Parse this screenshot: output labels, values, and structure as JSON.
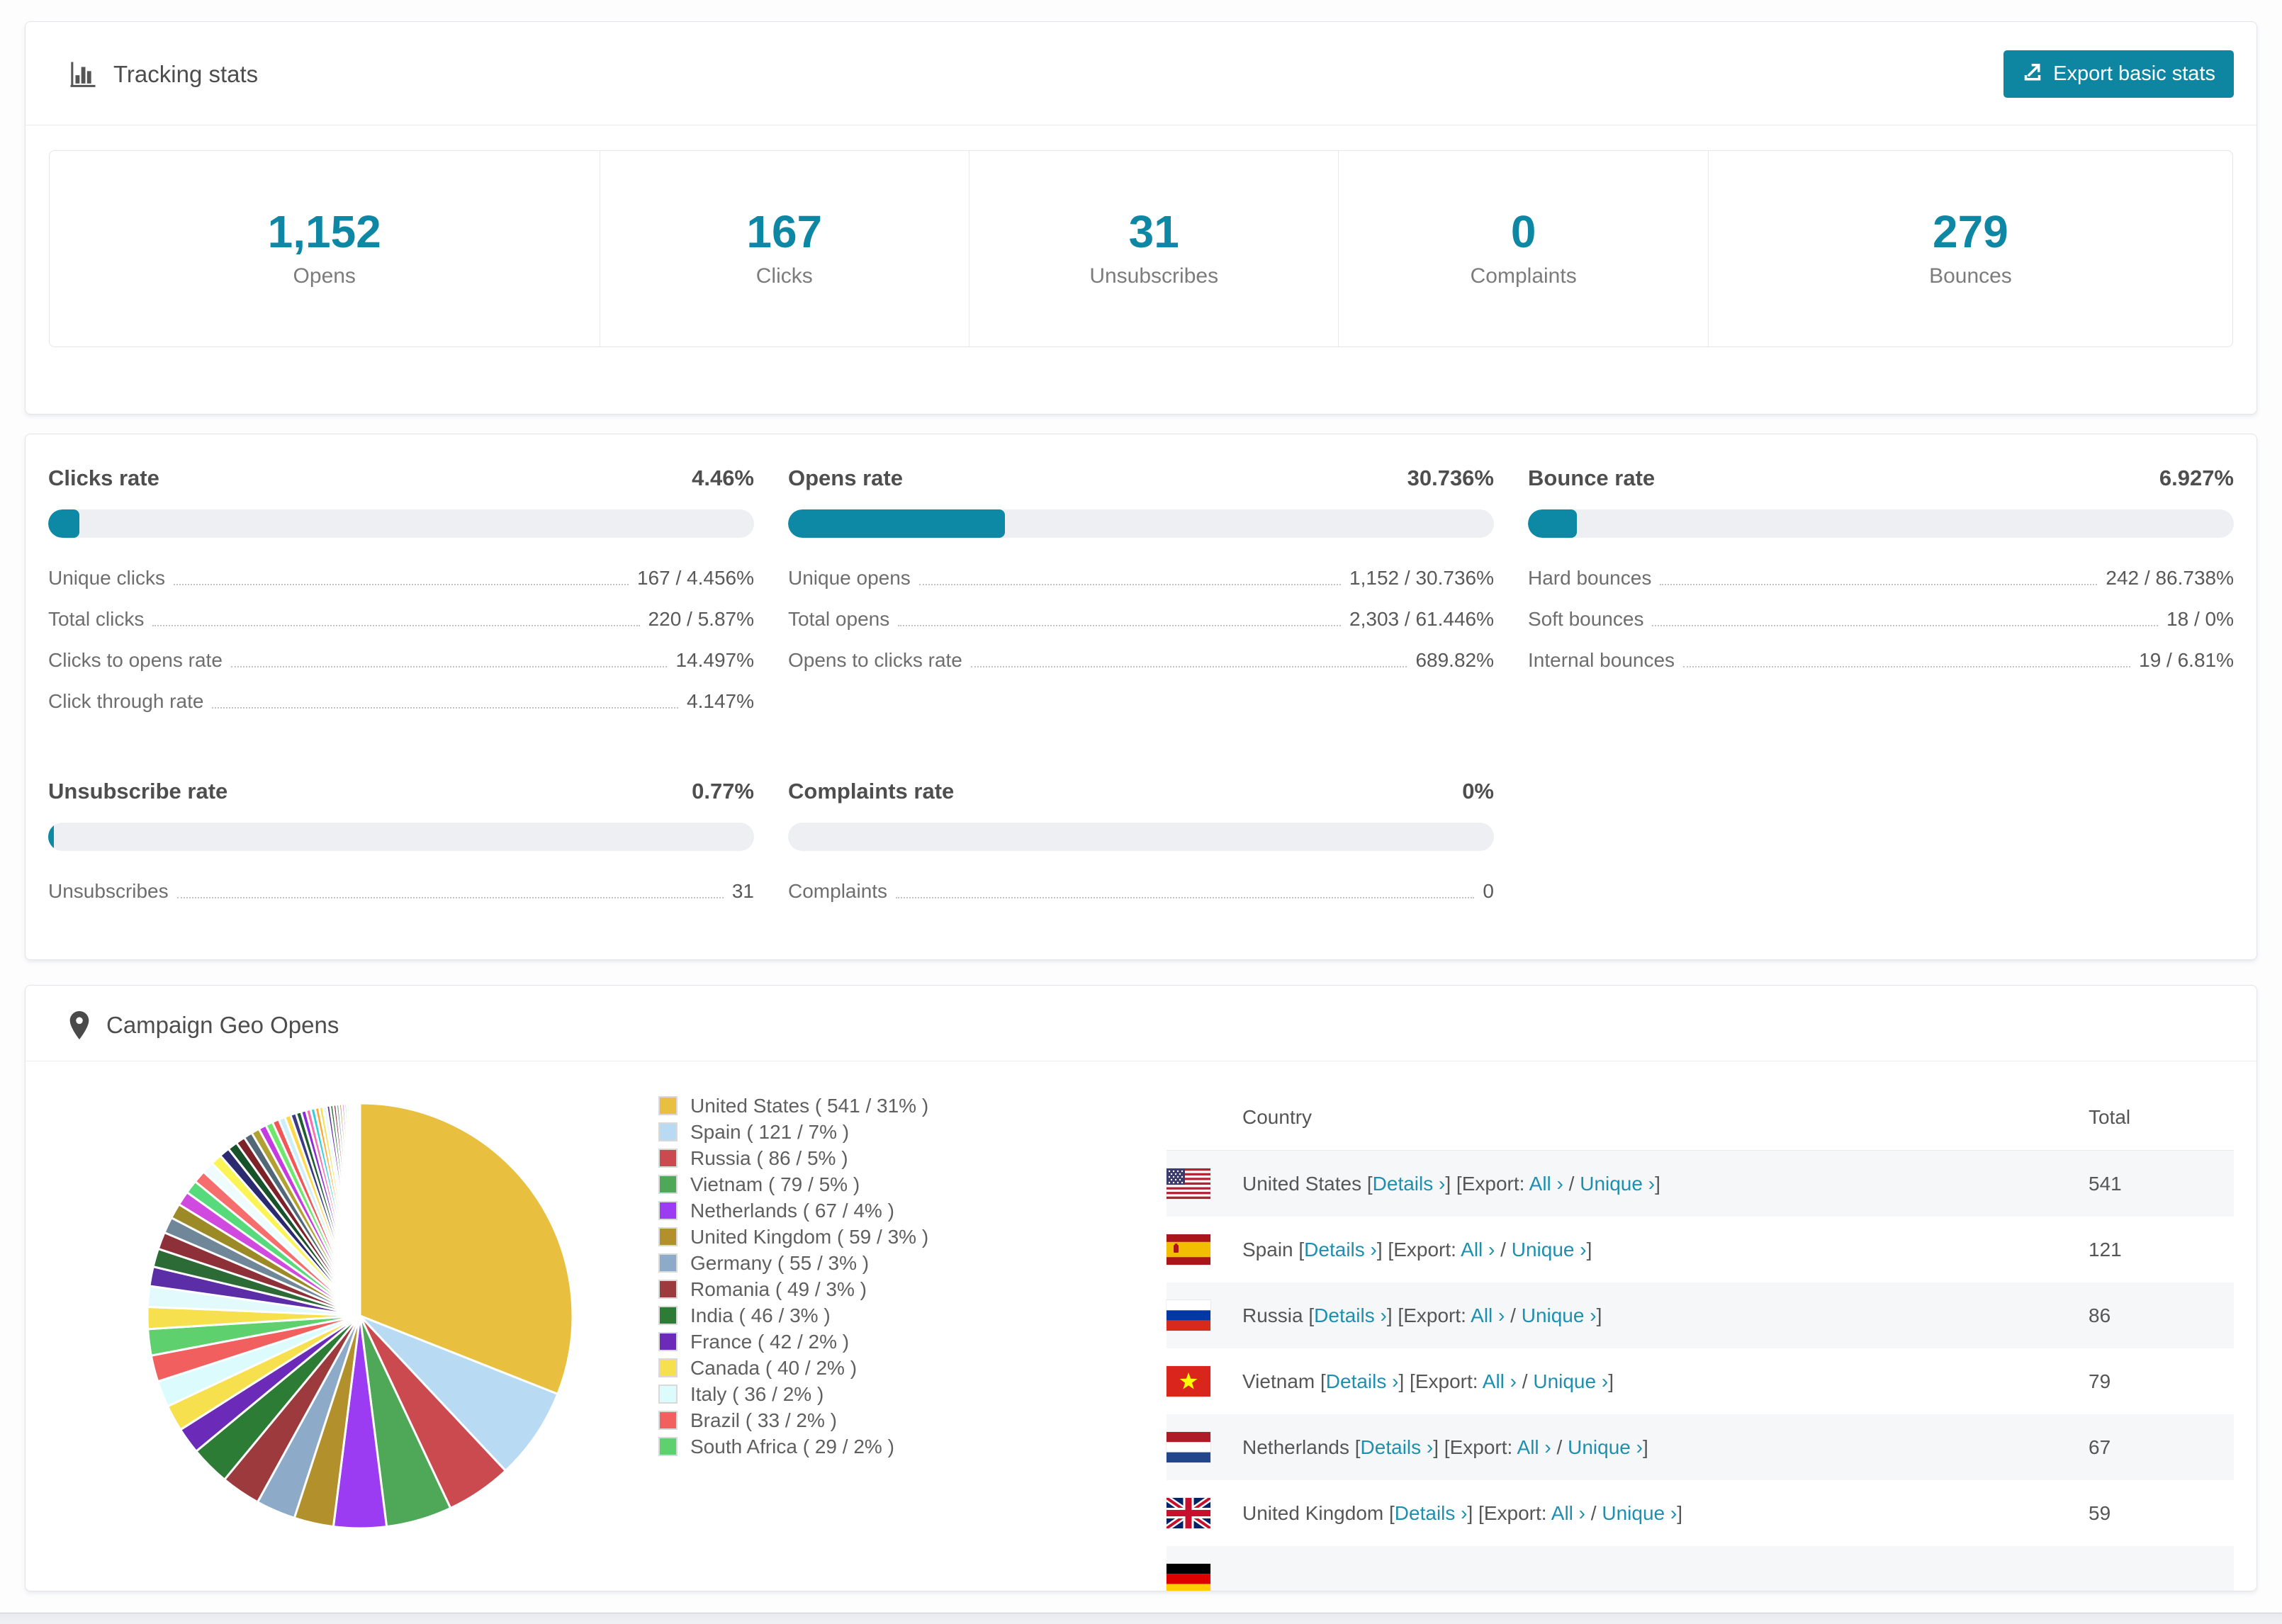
{
  "header": {
    "title": "Tracking stats",
    "export_label": "Export basic stats"
  },
  "summary_stats": [
    {
      "value": "1,152",
      "label": "Opens"
    },
    {
      "value": "167",
      "label": "Clicks"
    },
    {
      "value": "31",
      "label": "Unsubscribes"
    },
    {
      "value": "0",
      "label": "Complaints"
    },
    {
      "value": "279",
      "label": "Bounces"
    }
  ],
  "rate_cards": [
    {
      "title": "Clicks rate",
      "percent": "4.46%",
      "bar_pct": 4.46,
      "rows": [
        {
          "label": "Unique clicks",
          "value": "167 / 4.456%"
        },
        {
          "label": "Total clicks",
          "value": "220 / 5.87%"
        },
        {
          "label": "Clicks to opens rate",
          "value": "14.497%"
        },
        {
          "label": "Click through rate",
          "value": "4.147%"
        }
      ]
    },
    {
      "title": "Opens rate",
      "percent": "30.736%",
      "bar_pct": 30.736,
      "rows": [
        {
          "label": "Unique opens",
          "value": "1,152 / 30.736%"
        },
        {
          "label": "Total opens",
          "value": "2,303 / 61.446%"
        },
        {
          "label": "Opens to clicks rate",
          "value": "689.82%"
        }
      ]
    },
    {
      "title": "Bounce rate",
      "percent": "6.927%",
      "bar_pct": 6.927,
      "rows": [
        {
          "label": "Hard bounces",
          "value": "242 / 86.738%"
        },
        {
          "label": "Soft bounces",
          "value": "18 / 0%"
        },
        {
          "label": "Internal bounces",
          "value": "19 / 6.81%"
        }
      ]
    },
    {
      "title": "Unsubscribe rate",
      "percent": "0.77%",
      "bar_pct": 0.77,
      "rows": [
        {
          "label": "Unsubscribes",
          "value": "31"
        }
      ]
    },
    {
      "title": "Complaints rate",
      "percent": "0%",
      "bar_pct": 0,
      "rows": [
        {
          "label": "Complaints",
          "value": "0"
        }
      ]
    }
  ],
  "geo": {
    "title": "Campaign Geo Opens",
    "chart_data": {
      "type": "pie",
      "title": "Campaign Geo Opens",
      "start_angle_deg": 0,
      "direction": "clockwise",
      "legend_position": "right",
      "slices": [
        {
          "label": "United States",
          "count": 541,
          "percent": 31,
          "color": "#e8bf3e"
        },
        {
          "label": "Spain",
          "count": 121,
          "percent": 7,
          "color": "#b8dbf3"
        },
        {
          "label": "Russia",
          "count": 86,
          "percent": 5,
          "color": "#cb4a50"
        },
        {
          "label": "Vietnam",
          "count": 79,
          "percent": 5,
          "color": "#4fa857"
        },
        {
          "label": "Netherlands",
          "count": 67,
          "percent": 4,
          "color": "#9b3bf2"
        },
        {
          "label": "United Kingdom",
          "count": 59,
          "percent": 3,
          "color": "#b2902c"
        },
        {
          "label": "Germany",
          "count": 55,
          "percent": 3,
          "color": "#8dabc8"
        },
        {
          "label": "Romania",
          "count": 49,
          "percent": 3,
          "color": "#9d3a3d"
        },
        {
          "label": "India",
          "count": 46,
          "percent": 3,
          "color": "#2c7c36"
        },
        {
          "label": "France",
          "count": 42,
          "percent": 2,
          "color": "#6b2bb8"
        },
        {
          "label": "Canada",
          "count": 40,
          "percent": 2,
          "color": "#f6e04e"
        },
        {
          "label": "Italy",
          "count": 36,
          "percent": 2,
          "color": "#dcfbfd"
        },
        {
          "label": "Brazil",
          "count": 33,
          "percent": 2,
          "color": "#f15f5f"
        },
        {
          "label": "South Africa",
          "count": 29,
          "percent": 2,
          "color": "#5ed06d"
        }
      ],
      "others_percent": 26,
      "others_note": "remainder rendered as many small unlabeled slices",
      "tail_palette": [
        "#f6e04e",
        "#e3fafc",
        "#5b2da6",
        "#2c6b35",
        "#8d3038",
        "#6f8799",
        "#9c8a26",
        "#d14ae0",
        "#57da7c",
        "#f66d6d",
        "#eefcfe",
        "#fbf457",
        "#2b2a70",
        "#18522b",
        "#7c2228",
        "#526879",
        "#b1a132",
        "#c43ce0",
        "#6de86d",
        "#f25757",
        "#cdeffb",
        "#fed84c",
        "#3b3a87",
        "#1d5e2e",
        "#8a2bdc",
        "#f76fb2",
        "#30d0d8",
        "#fda52f"
      ]
    },
    "table": {
      "headers": [
        "Country",
        "Total"
      ],
      "link": {
        "details": "Details ›",
        "export_prefix": "Export:",
        "all": "All ›",
        "unique": "Unique ›"
      },
      "rows": [
        {
          "country": "United States",
          "total": "541",
          "flag": "us"
        },
        {
          "country": "Spain",
          "total": "121",
          "flag": "es"
        },
        {
          "country": "Russia",
          "total": "86",
          "flag": "ru"
        },
        {
          "country": "Vietnam",
          "total": "79",
          "flag": "vn"
        },
        {
          "country": "Netherlands",
          "total": "67",
          "flag": "nl"
        },
        {
          "country": "United Kingdom",
          "total": "59",
          "flag": "gb"
        }
      ],
      "partial_row": {
        "country": "",
        "total": "",
        "flag": "de"
      }
    }
  },
  "colors": {
    "accent": "#0d87a3",
    "link": "#1e8fae",
    "bar_track": "#edeff2",
    "export_button_bg": "#0e86a2"
  }
}
